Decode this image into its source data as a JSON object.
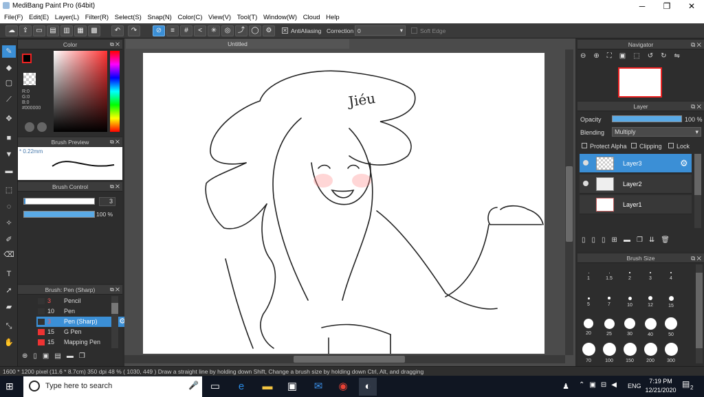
{
  "app": {
    "title": "MediBang Paint Pro (64bit)",
    "min": "─",
    "max": "❐",
    "close": "✕"
  },
  "menu": [
    "File(F)",
    "Edit(E)",
    "Layer(L)",
    "Filter(R)",
    "Select(S)",
    "Snap(N)",
    "Color(C)",
    "View(V)",
    "Tool(T)",
    "Window(W)",
    "Cloud",
    "Help"
  ],
  "toolbar": {
    "antialias_label": "AntiAliasing",
    "correction_label": "Correction",
    "correction_value": "0",
    "softedge_label": "Soft Edge"
  },
  "color_panel": {
    "title": "Color",
    "r": "R:0",
    "g": "G:0",
    "b": "B:0",
    "hex": "#000000"
  },
  "brush_preview": {
    "title": "Brush Preview",
    "size": "* 0.22mm"
  },
  "brush_control": {
    "title": "Brush Control",
    "size_value": "3",
    "opacity_value": "100 %",
    "opacity_fill": 1.0
  },
  "brush_list": {
    "title": "Brush: Pen (Sharp)",
    "items": [
      {
        "size": "3",
        "name": "Pencil",
        "color": "#333333",
        "size_color": "#ff5555"
      },
      {
        "size": "10",
        "name": "Pen",
        "color": "#333333",
        "size_color": "#dddddd"
      },
      {
        "size": "3",
        "name": "Pen (Sharp)",
        "color": "#333333",
        "size_color": "#ff5555",
        "selected": true
      },
      {
        "size": "15",
        "name": "G Pen",
        "color": "#ee3333",
        "size_color": "#dddddd"
      },
      {
        "size": "15",
        "name": "Mapping Pen",
        "color": "#ee3333",
        "size_color": "#dddddd"
      }
    ]
  },
  "document": {
    "tab": "Untitled"
  },
  "navigator": {
    "title": "Navigator"
  },
  "layer_panel": {
    "title": "Layer",
    "opacity_label": "Opacity",
    "opacity_value": "100 %",
    "opacity_fill": 1.0,
    "blending_label": "Blending",
    "blending_value": "Multiply",
    "protect_alpha": "Protect Alpha",
    "clipping": "Clipping",
    "lock": "Lock",
    "layers": [
      {
        "name": "Layer3",
        "selected": true
      },
      {
        "name": "Layer2"
      },
      {
        "name": "Layer1"
      }
    ]
  },
  "brush_size": {
    "title": "Brush Size",
    "sizes": [
      "1",
      "1.5",
      "2",
      "3",
      "4",
      "5",
      "7",
      "10",
      "12",
      "15",
      "20",
      "25",
      "30",
      "40",
      "50",
      "70",
      "100",
      "150",
      "200",
      "300"
    ]
  },
  "status": {
    "text": "1600 * 1200 pixel   (11.6 * 8.7cm)   350 dpi   48 %   ( 1030, 449 )   Draw a straight line by holding down Shift, Change a brush size by holding down Ctrl, Alt, and dragging"
  },
  "taskbar": {
    "search_placeholder": "Type here to search",
    "lang": "ENG",
    "time": "7:19 PM",
    "date": "12/21/2020",
    "notif": "2"
  }
}
